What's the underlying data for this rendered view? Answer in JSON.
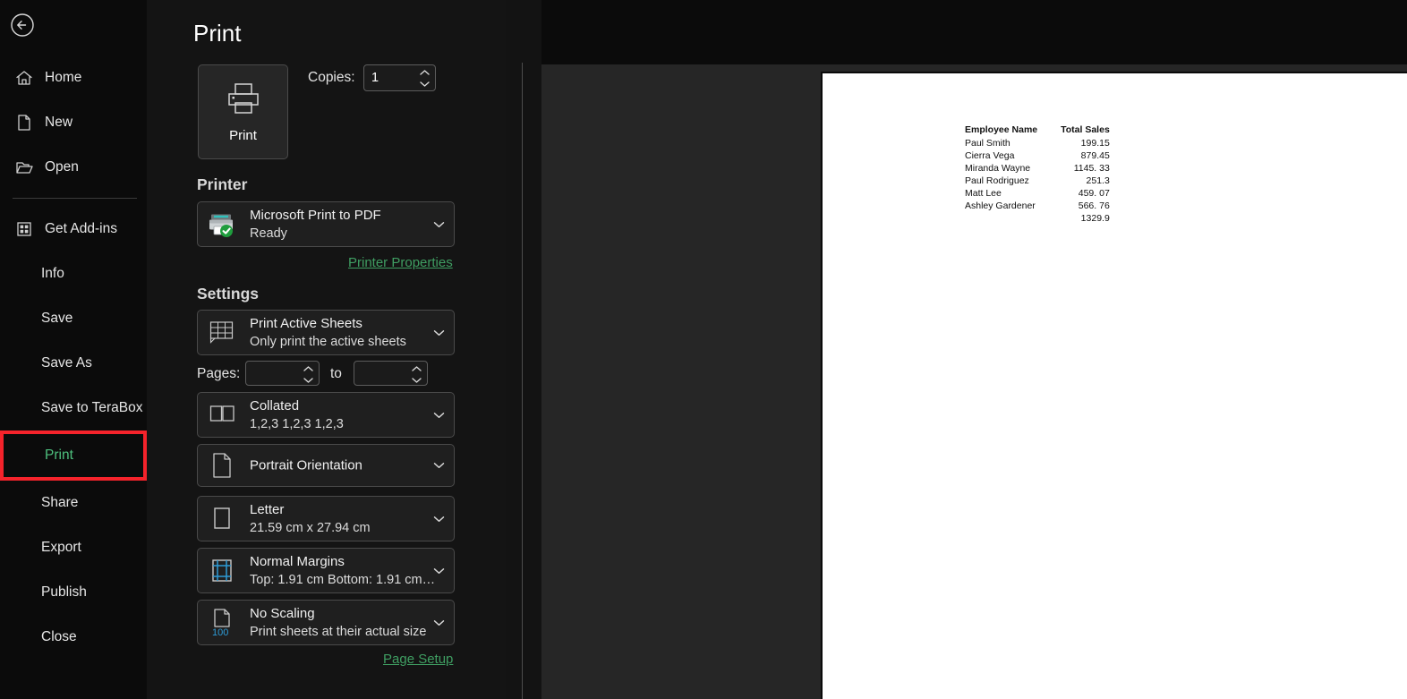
{
  "app": {
    "page_title": "Print"
  },
  "sidebar": {
    "back_icon": "back-arrow-icon",
    "items": [
      {
        "label": "Home",
        "icon": "home-icon",
        "has_icon": true,
        "selected": false
      },
      {
        "label": "New",
        "icon": "new-file-icon",
        "has_icon": true,
        "selected": false
      },
      {
        "label": "Open",
        "icon": "folder-open-icon",
        "has_icon": true,
        "selected": false
      },
      {
        "label": "Get Add-ins",
        "icon": "add-ins-icon",
        "has_icon": true,
        "selected": false
      },
      {
        "label": "Info",
        "icon": "",
        "has_icon": false,
        "selected": false
      },
      {
        "label": "Save",
        "icon": "",
        "has_icon": false,
        "selected": false
      },
      {
        "label": "Save As",
        "icon": "",
        "has_icon": false,
        "selected": false
      },
      {
        "label": "Save to TeraBox",
        "icon": "",
        "has_icon": false,
        "selected": false
      },
      {
        "label": "Print",
        "icon": "",
        "has_icon": false,
        "selected": true
      },
      {
        "label": "Share",
        "icon": "",
        "has_icon": false,
        "selected": false
      },
      {
        "label": "Export",
        "icon": "",
        "has_icon": false,
        "selected": false
      },
      {
        "label": "Publish",
        "icon": "",
        "has_icon": false,
        "selected": false
      },
      {
        "label": "Close",
        "icon": "",
        "has_icon": false,
        "selected": false
      }
    ]
  },
  "print_panel": {
    "print_button_label": "Print",
    "print_button_icon": "printer-icon",
    "copies_label": "Copies:",
    "copies_value": "1",
    "printer_section_title": "Printer",
    "printer_info_icon": "info-circle-icon",
    "printer_name": "Microsoft Print to PDF",
    "printer_status": "Ready",
    "printer_icon": "printer-device-icon",
    "printer_status_badge": "green-check-badge",
    "printer_properties_link": "Printer Properties",
    "settings_section_title": "Settings",
    "settings": [
      {
        "name": "print-area",
        "icon": "sheet-grid-icon",
        "primary": "Print Active Sheets",
        "secondary": "Only print the active sheets"
      },
      {
        "name": "collation",
        "icon": "collate-pages-icon",
        "primary": "Collated",
        "secondary": "1,2,3    1,2,3    1,2,3"
      },
      {
        "name": "orientation",
        "icon": "portrait-page-icon",
        "primary": "Portrait Orientation",
        "secondary": ""
      },
      {
        "name": "paper-size",
        "icon": "paper-size-icon",
        "primary": "Letter",
        "secondary": "21.59 cm x 27.94 cm"
      },
      {
        "name": "margins",
        "icon": "margins-icon",
        "primary": "Normal Margins",
        "secondary": "Top: 1.91 cm Bottom: 1.91 cm…"
      },
      {
        "name": "scaling",
        "icon": "scaling-100-icon",
        "primary": "No Scaling",
        "secondary": "Print sheets at their actual size",
        "badge": "100"
      }
    ],
    "pages_label": "Pages:",
    "pages_from_value": "",
    "pages_to_value": "",
    "pages_to_label": "to",
    "page_setup_link": "Page Setup"
  },
  "preview": {
    "document": {
      "columns": [
        "Employee Name",
        "Total Sales"
      ],
      "rows": [
        {
          "name": "Paul Smith",
          "sales": "199.15"
        },
        {
          "name": "Cierra Vega",
          "sales": "879.45"
        },
        {
          "name": "Miranda Wayne",
          "sales": "1145. 33"
        },
        {
          "name": "Paul Rodriguez",
          "sales": "251.3"
        },
        {
          "name": "Matt Lee",
          "sales": "459. 07"
        },
        {
          "name": "Ashley Gardener",
          "sales": "566. 76"
        },
        {
          "name": "",
          "sales": "1329.9"
        }
      ]
    }
  },
  "colors": {
    "accent_green": "#3f9e62",
    "selection_red": "#f5232b",
    "selected_text_green": "#4ec07e",
    "accent_blue": "#2e9bd6",
    "sidebar_bg": "#0b0b0b",
    "panel_bg": "#141414"
  }
}
